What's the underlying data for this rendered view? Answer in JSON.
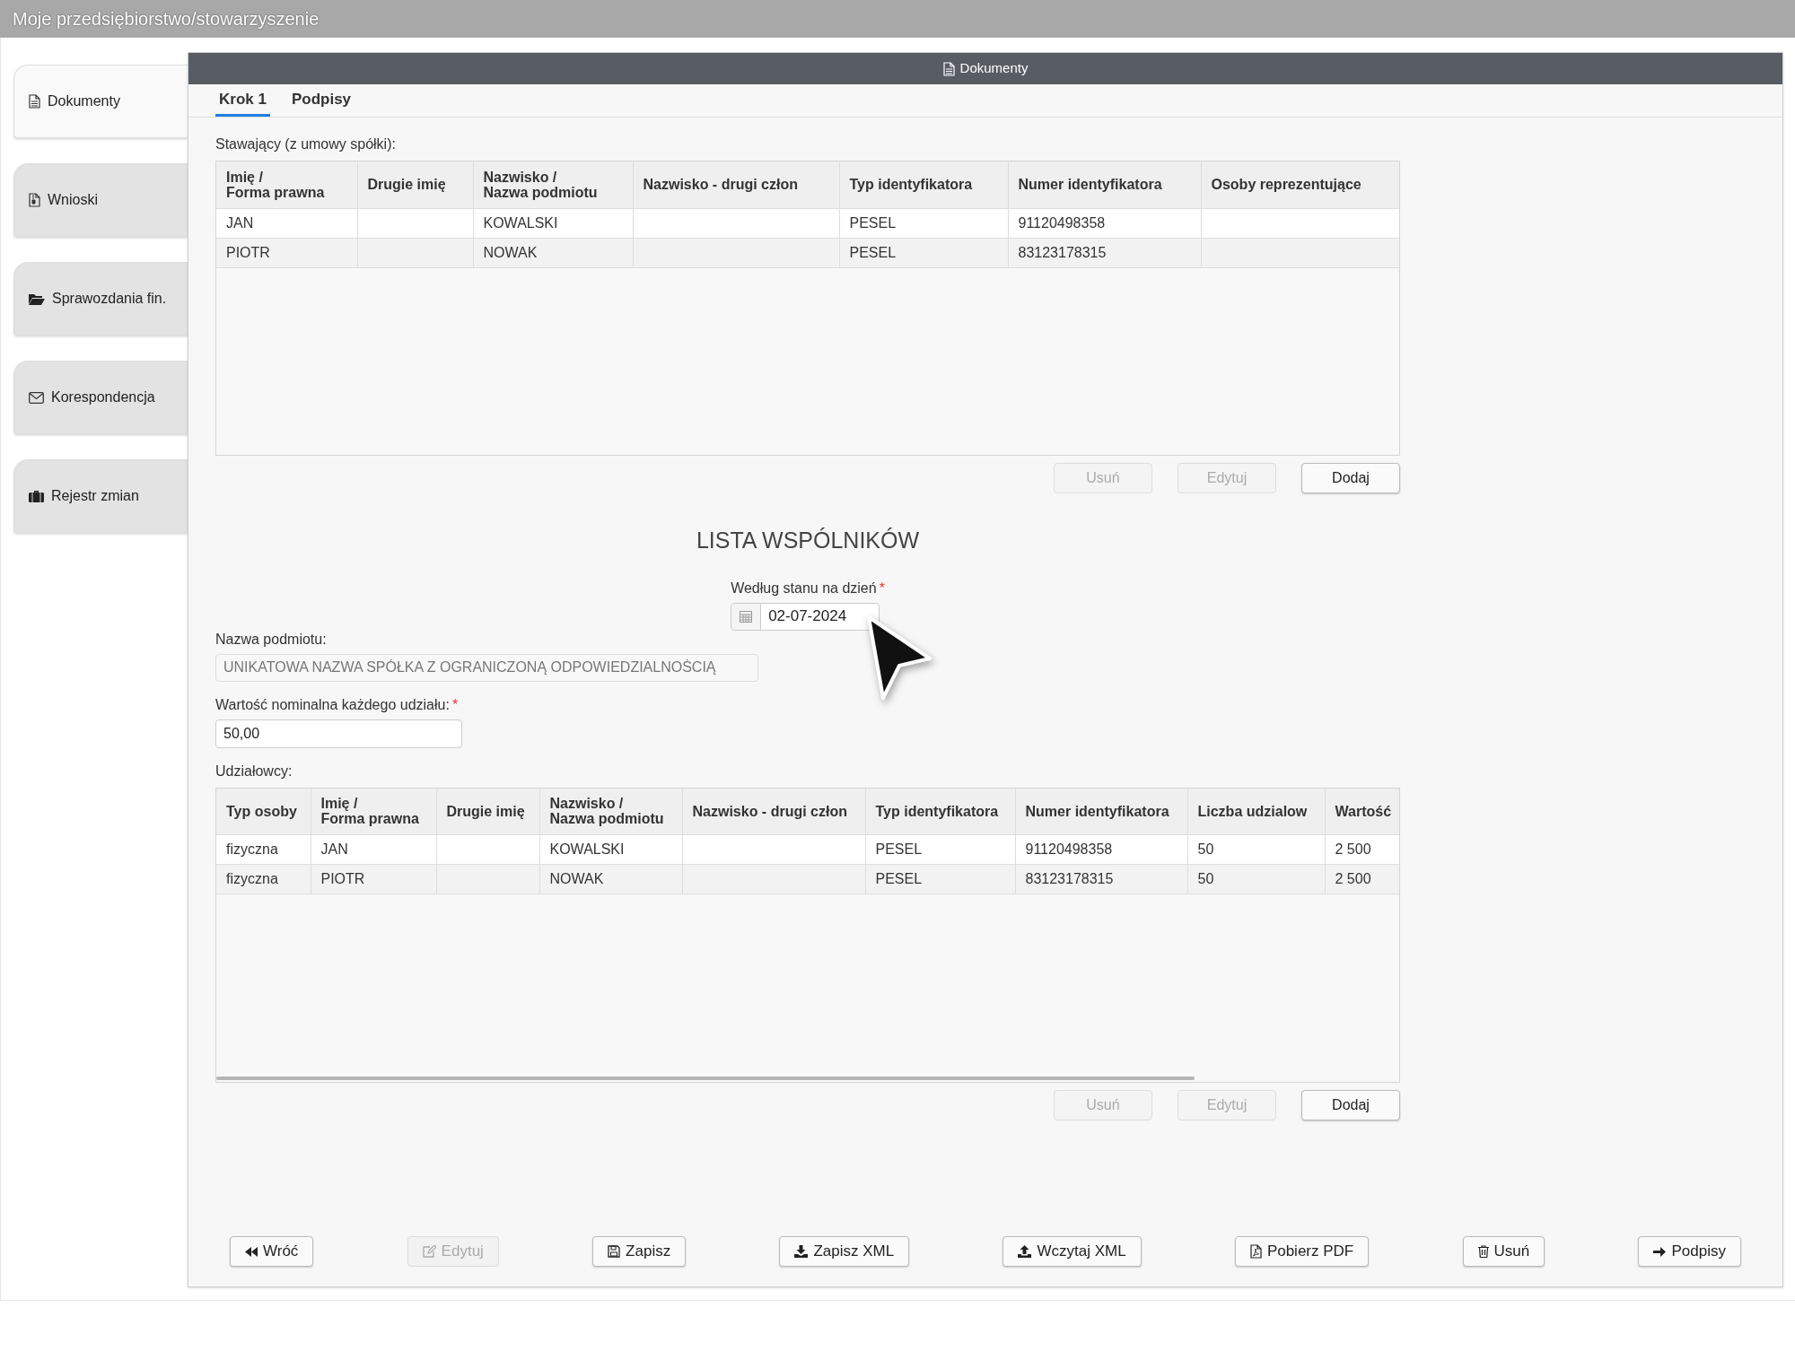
{
  "app_title": "Moje przedsiębiorstwo/stowarzyszenie",
  "sidebar": {
    "items": [
      {
        "label": "Dokumenty",
        "selected": true
      },
      {
        "label": "Wnioski",
        "selected": false
      },
      {
        "label": "Sprawozdania fin.",
        "selected": false
      },
      {
        "label": "Korespondencja",
        "selected": false
      },
      {
        "label": "Rejestr zmian",
        "selected": false
      }
    ]
  },
  "panel": {
    "title": "Dokumenty",
    "tabs": [
      {
        "label": "Krok 1",
        "selected": true
      },
      {
        "label": "Podpisy",
        "selected": false
      }
    ],
    "founders": {
      "label": "Stawający (z umowy spółki):",
      "columns": [
        "Imię /\nForma prawna",
        "Drugie imię",
        "Nazwisko /\nNazwa podmiotu",
        "Nazwisko - drugi człon",
        "Typ identyfikatora",
        "Numer identyfikatora",
        "Osoby reprezentujące"
      ],
      "rows": [
        [
          "JAN",
          null,
          "KOWALSKI",
          null,
          "PESEL",
          "91120498358",
          null
        ],
        [
          "PIOTR",
          null,
          "NOWAK",
          null,
          "PESEL",
          "83123178315",
          null
        ]
      ],
      "buttons": [
        {
          "label": "Usuń",
          "disabled": true
        },
        {
          "label": "Edytuj",
          "disabled": true
        },
        {
          "label": "Dodaj",
          "disabled": false
        }
      ]
    },
    "section_title": "LISTA WSPÓLNIKÓW",
    "date": {
      "label": "Według stanu na dzień",
      "required_mark": "*",
      "value": "02-07-2024"
    },
    "entity_name": {
      "label": "Nazwa podmiotu:",
      "value": "UNIKATOWA NAZWA SPÓŁKA Z OGRANICZONĄ ODPOWIEDZIALNOŚCIĄ",
      "disabled": true
    },
    "nominal_value": {
      "label": "Wartość nominalna każdego udziału:",
      "required_mark": "*",
      "value": "50,00",
      "disabled": false
    },
    "shareholders": {
      "label": "Udziałowcy:",
      "columns": [
        "Typ osoby",
        "Imię /\nForma prawna",
        "Drugie imię",
        "Nazwisko /\nNazwa podmiotu",
        "Nazwisko - drugi człon",
        "Typ identyfikatora",
        "Numer identyfikatora",
        "Liczba udzialow",
        "Wartość"
      ],
      "rows": [
        [
          "fizyczna",
          "JAN",
          null,
          "KOWALSKI",
          null,
          "PESEL",
          "91120498358",
          "50",
          "2 500"
        ],
        [
          "fizyczna",
          "PIOTR",
          null,
          "NOWAK",
          null,
          "PESEL",
          "83123178315",
          "50",
          "2 500"
        ]
      ],
      "buttons": [
        {
          "label": "Usuń",
          "disabled": true
        },
        {
          "label": "Edytuj",
          "disabled": true
        },
        {
          "label": "Dodaj",
          "disabled": false
        }
      ]
    },
    "footer_buttons": [
      {
        "label": "Wróć",
        "disabled": false
      },
      {
        "label": "Edytuj",
        "disabled": true
      },
      {
        "label": "Zapisz",
        "disabled": false
      },
      {
        "label": "Zapisz XML",
        "disabled": false
      },
      {
        "label": "Wczytaj XML",
        "disabled": false
      },
      {
        "label": "Pobierz PDF",
        "disabled": false
      },
      {
        "label": "Usuń",
        "disabled": false
      },
      {
        "label": "Podpisy",
        "disabled": false
      }
    ]
  }
}
